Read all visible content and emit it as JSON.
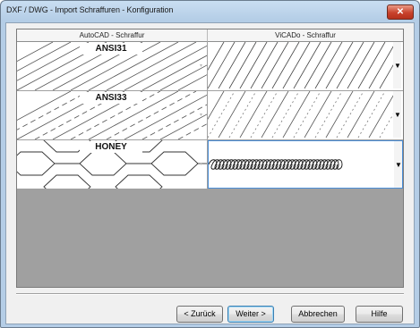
{
  "window": {
    "title": "DXF / DWG - Import    Schraffuren  - Konfiguration",
    "close_glyph": "✕"
  },
  "grid": {
    "columns": [
      "AutoCAD - Schraffur",
      "ViCADo - Schraffur"
    ],
    "rows": [
      {
        "autocad_pattern": "ANSI31",
        "vicado_pattern": "diagonal-lines"
      },
      {
        "autocad_pattern": "ANSI33",
        "vicado_pattern": "diagonal-dashed-lines"
      },
      {
        "autocad_pattern": "HONEY",
        "vicado_pattern": "loops",
        "selected": true
      }
    ]
  },
  "buttons": {
    "back": "< Zurück",
    "next": "Weiter >",
    "cancel": "Abbrechen",
    "help": "Hilfe"
  },
  "icons": {
    "left_dropdown_arrow": "▾",
    "right_dropdown_arrow": "▼"
  }
}
